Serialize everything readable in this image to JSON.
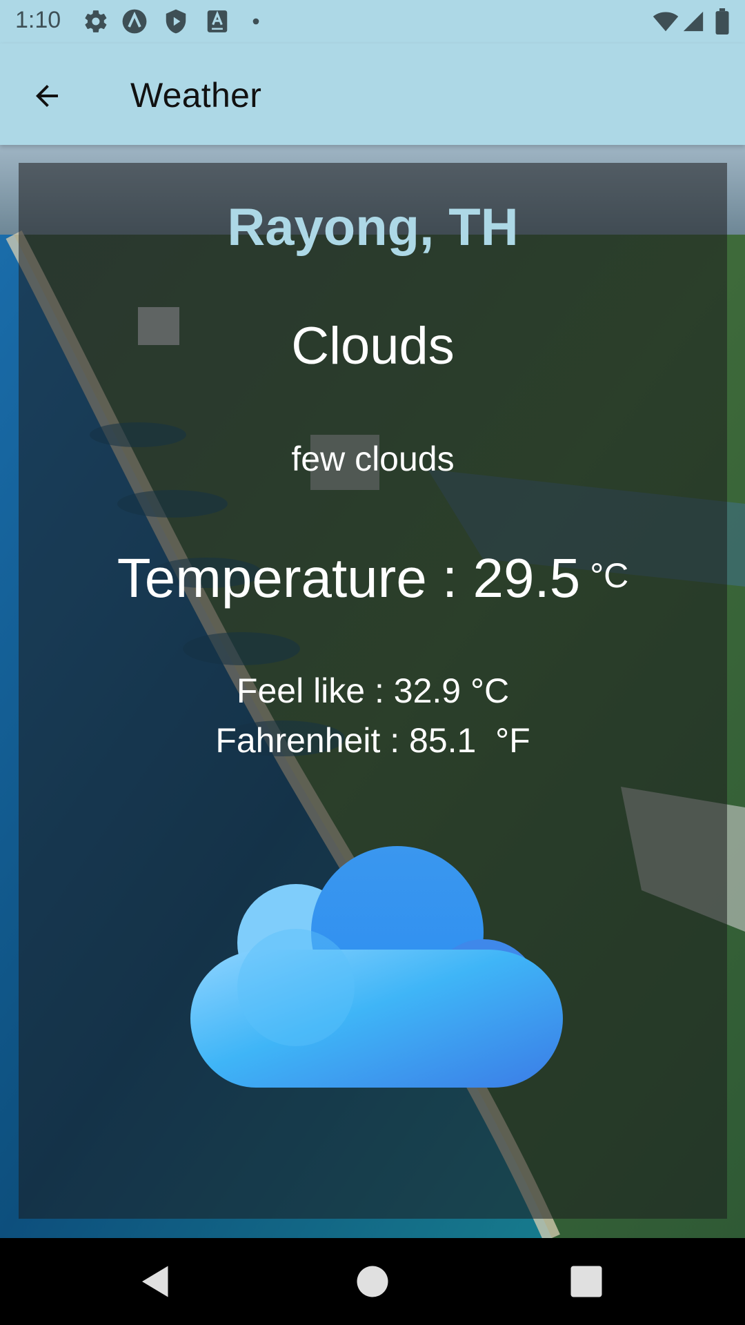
{
  "status_bar": {
    "time": "1:10",
    "left_icons": [
      "gear-icon",
      "app-a-icon",
      "shield-play-icon",
      "keyboard-a-icon",
      "dot-icon"
    ],
    "right_icons": [
      "wifi-icon",
      "signal-icon",
      "battery-icon"
    ]
  },
  "app_bar": {
    "title": "Weather",
    "back_icon": "arrow-back-icon"
  },
  "weather": {
    "city": "Rayong, TH",
    "condition": "Clouds",
    "description": "few clouds",
    "temperature_label": "Temperature : ",
    "temperature_value": "29.5",
    "temperature_unit": "°C",
    "feels_like": "Feel like : 32.9 °C",
    "fahrenheit": "Fahrenheit : 85.1  °F",
    "icon": "cloud-icon"
  },
  "nav_bar": {
    "icons": [
      "nav-back-icon",
      "nav-home-icon",
      "nav-recents-icon"
    ]
  },
  "colors": {
    "accent": "#add8e6",
    "card_overlay": "#1c1c1e",
    "text": "#ffffff",
    "nav_bar": "#000000"
  }
}
